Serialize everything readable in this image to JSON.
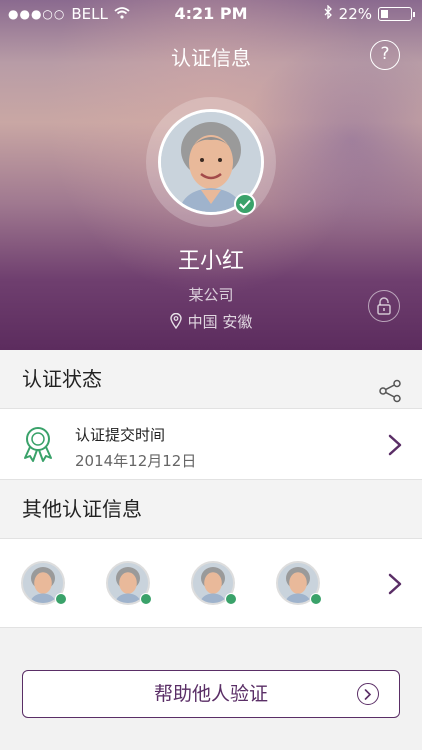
{
  "status_bar": {
    "signal": "●●●○○",
    "carrier": "BELL",
    "time": "4:21 PM",
    "battery": "22%"
  },
  "header": {
    "title": "认证信息",
    "help_label": "?"
  },
  "profile": {
    "name": "王小红",
    "company": "某公司",
    "location": "中国 安徽"
  },
  "status_section": {
    "title": "认证状态"
  },
  "certification": {
    "title": "认证提交时间",
    "date": "2014年12月12日"
  },
  "others_section": {
    "title": "其他认证信息",
    "avatars": [
      "avatar-1",
      "avatar-2",
      "avatar-3",
      "avatar-4"
    ]
  },
  "footer": {
    "help_verify_label": "帮助他人验证"
  },
  "colors": {
    "accent": "#5a2e66",
    "verified": "#3aa26a"
  },
  "icons": [
    "wifi-icon",
    "bluetooth-icon",
    "battery-icon",
    "help-icon",
    "verified-check-icon",
    "location-pin-icon",
    "lock-icon",
    "share-icon",
    "award-icon",
    "chevron-right-icon",
    "arrow-circle-right-icon"
  ]
}
